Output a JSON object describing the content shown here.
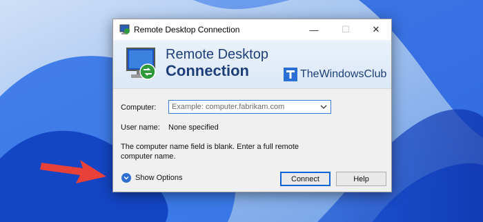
{
  "window": {
    "title": "Remote Desktop Connection",
    "minimize_glyph": "—",
    "maximize_glyph": "☐",
    "close_glyph": "✕"
  },
  "banner": {
    "line1": "Remote Desktop",
    "line2": "Connection",
    "watermark": "TheWindowsClub"
  },
  "form": {
    "computer_label": "Computer:",
    "computer_placeholder": "Example: computer.fabrikam.com",
    "computer_value": "",
    "username_label": "User name:",
    "username_value": "None specified",
    "message": "The computer name field is blank. Enter a full remote computer name."
  },
  "footer": {
    "show_options": "Show Options",
    "connect": "Connect",
    "help": "Help"
  },
  "icons": {
    "app": "remote-desktop-icon",
    "options": "chevron-down-circle-icon",
    "combo_arrow": "chevron-down-icon",
    "annotation": "red-arrow"
  },
  "colors": {
    "accent": "#0a64d6",
    "banner_text": "#1d3e78",
    "arrow": "#e8413a"
  }
}
